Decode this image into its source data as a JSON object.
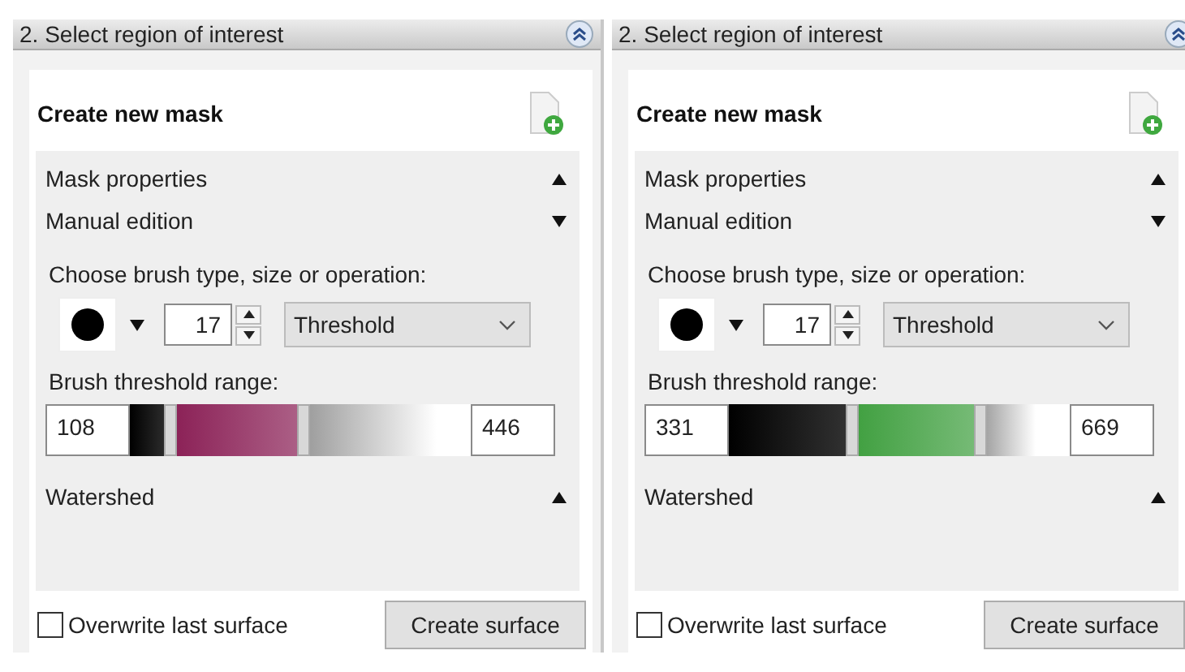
{
  "panels": [
    {
      "title": "2. Select region of interest",
      "card_title": "Create new mask",
      "sections": [
        {
          "label": "Mask properties",
          "expanded": false
        },
        {
          "label": "Manual edition",
          "expanded": true
        }
      ],
      "brush_label": "Choose brush type, size or operation:",
      "brush_size": "17",
      "operation": "Threshold",
      "range_label": "Brush threshold range:",
      "range": {
        "min": "108",
        "max": "446",
        "color": "#8a1f55",
        "low_handle": {
          "level": 0.12
        },
        "high_handle": {
          "level": 0.51
        }
      },
      "watershed": {
        "label": "Watershed",
        "expanded": false
      },
      "overwrite": {
        "label": "Overwrite last surface",
        "checked": false
      },
      "button": "Create surface"
    },
    {
      "title": "2. Select region of interest",
      "card_title": "Create new mask",
      "sections": [
        {
          "label": "Mask properties",
          "expanded": false
        },
        {
          "label": "Manual edition",
          "expanded": true
        }
      ],
      "brush_label": "Choose brush type, size or operation:",
      "brush_size": "17",
      "operation": "Threshold",
      "range_label": "Brush threshold range:",
      "range": {
        "min": "331",
        "max": "669",
        "color": "#3f9f3f",
        "low_handle": {
          "level": 0.36
        },
        "high_handle": {
          "level": 0.74
        }
      },
      "watershed": {
        "label": "Watershed",
        "expanded": false
      },
      "overwrite": {
        "label": "Overwrite last surface",
        "checked": false
      },
      "button": "Create surface"
    }
  ]
}
